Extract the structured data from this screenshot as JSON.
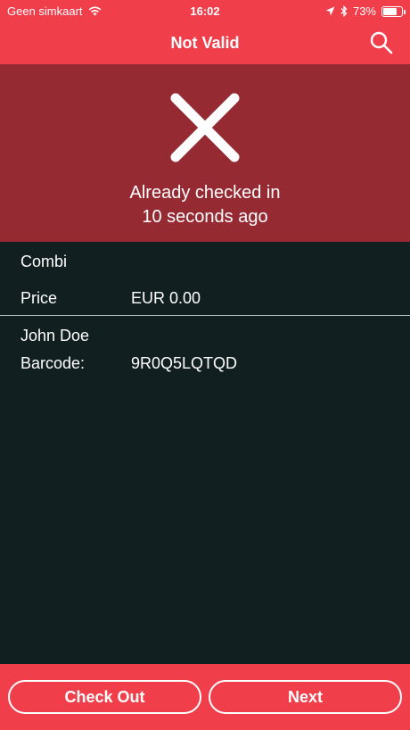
{
  "status_bar": {
    "carrier": "Geen simkaart",
    "time": "16:02",
    "battery_text": "73%",
    "battery_level": 0.73
  },
  "nav": {
    "title": "Not Valid"
  },
  "result": {
    "message_line1": "Already checked in",
    "message_line2": "10 seconds ago"
  },
  "ticket": {
    "name": "Combi",
    "price_label": "Price",
    "price_value": "EUR 0.00"
  },
  "attendee": {
    "name": "John Doe",
    "barcode_label": "Barcode:",
    "barcode_value": "9R0Q5LQTQD"
  },
  "actions": {
    "checkout_label": "Check Out",
    "next_label": "Next"
  },
  "colors": {
    "accent": "#f03e4b",
    "banner": "#952a33",
    "background": "#121f21"
  }
}
